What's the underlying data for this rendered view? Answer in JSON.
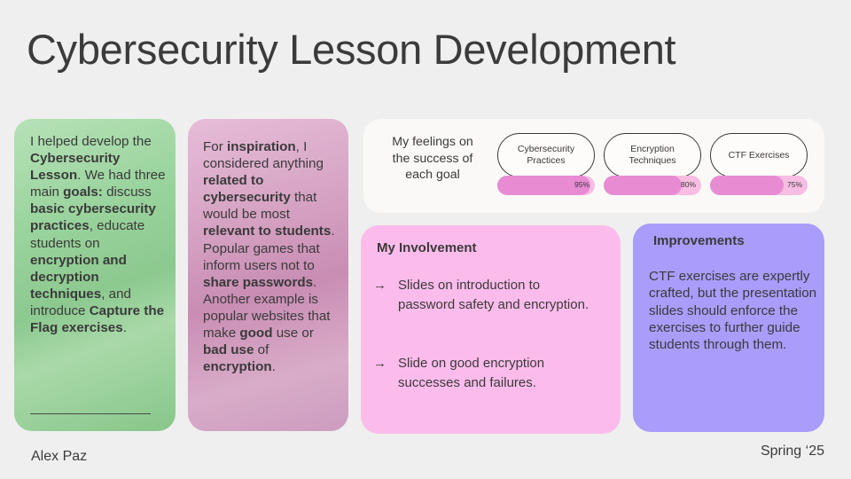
{
  "slide": {
    "title": "Cybersecurity Lesson Development",
    "author": "Alex Paz",
    "term": "Spring ‘25"
  },
  "goals_card": {
    "segments": [
      {
        "text": "I helped develop the ",
        "bold": false
      },
      {
        "text": "Cybersecurity Lesson",
        "bold": true
      },
      {
        "text": ". We had three main ",
        "bold": false
      },
      {
        "text": "goals:",
        "bold": true
      },
      {
        "text": " discuss ",
        "bold": false
      },
      {
        "text": "basic cybersecurity practices",
        "bold": true
      },
      {
        "text": ", educate students on ",
        "bold": false
      },
      {
        "text": "encryption and decryption techniques",
        "bold": true
      },
      {
        "text": ", and introduce ",
        "bold": false
      },
      {
        "text": "Capture the Flag exercises",
        "bold": true
      },
      {
        "text": ".",
        "bold": false
      }
    ]
  },
  "inspiration_card": {
    "segments": [
      {
        "text": "For ",
        "bold": false
      },
      {
        "text": "inspiration",
        "bold": true
      },
      {
        "text": ", I considered anything ",
        "bold": false
      },
      {
        "text": "related to cybersecurity",
        "bold": true
      },
      {
        "text": " that would be most ",
        "bold": false
      },
      {
        "text": "relevant to students",
        "bold": true
      },
      {
        "text": ". Popular games that inform users not to ",
        "bold": false
      },
      {
        "text": "share passwords",
        "bold": true
      },
      {
        "text": ". Another example is popular websites that make ",
        "bold": false
      },
      {
        "text": "good",
        "bold": true
      },
      {
        "text": " use or ",
        "bold": false
      },
      {
        "text": "bad use",
        "bold": true
      },
      {
        "text": " of ",
        "bold": false
      },
      {
        "text": "encryption",
        "bold": true
      },
      {
        "text": ".",
        "bold": false
      }
    ]
  },
  "feelings": {
    "label": "My feelings on the success of each goal",
    "goals": [
      {
        "name": "Cybersecurity Practices",
        "percent_label": "95%",
        "value": 0.95
      },
      {
        "name": "Encryption Techniques",
        "percent_label": "80%",
        "value": 0.8
      },
      {
        "name": "CTF Exercises",
        "percent_label": "75%",
        "value": 0.75
      }
    ],
    "colors": {
      "track": "#f7bde3",
      "fill": "#e78bd3"
    }
  },
  "involvement": {
    "title": "My Involvement",
    "arrow": "→",
    "items": [
      "Slides on introduction to password safety and encryption.",
      "Slide on good encryption successes and failures."
    ]
  },
  "improvements": {
    "title": "Improvements",
    "text": "CTF exercises are expertly crafted, but the presentation slides should enforce the exercises to further guide students through them."
  },
  "colors": {
    "background": "#efefef",
    "green_card": "#9bd49e",
    "pink_card": "#d4a0c1",
    "involvement_card": "#fbbceb",
    "improvements_card": "#a99cfb"
  }
}
